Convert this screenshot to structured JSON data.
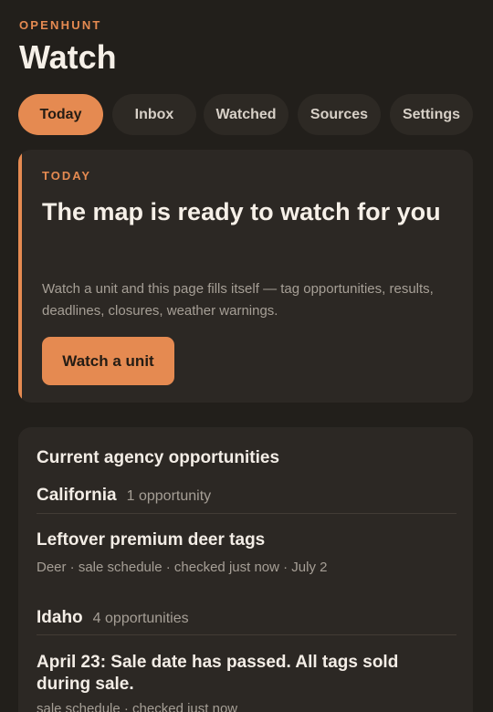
{
  "app": {
    "brand": "OPENHUNT",
    "page_title": "Watch"
  },
  "tabs": [
    {
      "label": "Today",
      "active": true
    },
    {
      "label": "Inbox",
      "active": false
    },
    {
      "label": "Watched",
      "active": false
    },
    {
      "label": "Sources",
      "active": false
    },
    {
      "label": "Settings",
      "active": false
    }
  ],
  "hero": {
    "eyebrow": "TODAY",
    "heading": "The map is ready to watch for you",
    "body": "Watch a unit and this page fills itself — tag opportunities, results, deadlines, closures, weather warnings.",
    "button_label": "Watch a unit"
  },
  "opportunities": {
    "title": "Current agency opportunities",
    "groups": [
      {
        "name": "California",
        "count": "1 opportunity",
        "items": [
          {
            "title": "Leftover premium deer tags",
            "meta": "Deer · sale schedule · checked just now · July 2"
          }
        ]
      },
      {
        "name": "Idaho",
        "count": "4 opportunities",
        "items": [
          {
            "title": "April 23: Sale date has passed. All tags sold during sale.",
            "meta": "sale schedule · checked just now"
          }
        ]
      }
    ]
  },
  "colors": {
    "background": "#221f1b",
    "card": "#2c2824",
    "accent": "#e58a51",
    "text": "#f3ede6",
    "muted": "#a69f96"
  }
}
